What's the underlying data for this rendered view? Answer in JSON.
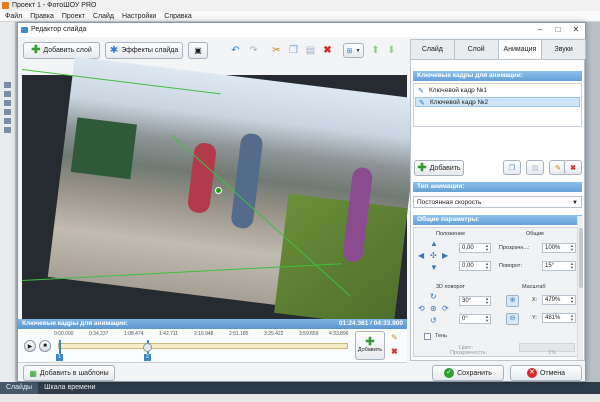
{
  "app": {
    "title": "Проект 1 - ФотоШОУ PRO",
    "menu": [
      "Файл",
      "Правка",
      "Проект",
      "Слайд",
      "Настройки",
      "Справка"
    ],
    "bottom_tabs": [
      "Слайды",
      "Шкала времени"
    ],
    "status": ""
  },
  "dialog": {
    "title": "Редактор слайда",
    "toolbar": {
      "add_layer": "Добавить слой",
      "slide_effects": "Эффекты слайда"
    },
    "timeline": {
      "header": "Ключевые кадры для анимации:",
      "time": "01:24.361 / 04:33.900",
      "ticks": [
        "0:00.000",
        "0:34.237",
        "1:08.474",
        "1:42.711",
        "2:16.948",
        "2:51.185",
        "3:25.422",
        "3:59.659",
        "4:33.896"
      ],
      "markers": [
        "1",
        "2"
      ],
      "add_label": "Добавить"
    },
    "tabs": [
      "Слайд",
      "Слой",
      "Анимация",
      "Звуки"
    ],
    "active_tab": "Анимация",
    "panel": {
      "keyframes_header": "Ключевые кадры для анимации:",
      "keyframes": [
        "Ключевой кадр №1",
        "Ключевой кадр №2"
      ],
      "add_label": "Добавить",
      "anim_type_header": "Тип анимации:",
      "anim_type_value": "Постоянная скорость",
      "params_header": "Общие параметры:",
      "position_label": "Положение",
      "general_label": "Общие",
      "pos_x": "0,00",
      "pos_y": "0,00",
      "opacity_label": "Прозрачн...:",
      "opacity_value": "100%",
      "rotate_label": "Поворот:",
      "rotate_value": "15°",
      "rot3d_label": "3D поворот",
      "scale_label": "Масштаб",
      "rot3d_a": "30°",
      "rot3d_b": "0°",
      "scale_x_label": "X:",
      "scale_x": "479%",
      "scale_y_label": "Y:",
      "scale_y": "481%",
      "shadow_label": "Тень",
      "color_label": "Цвет:",
      "transparency_label": "Прозрачность:",
      "transparency_value": "1%"
    },
    "buttons": {
      "templates": "Добавить в шаблоны",
      "save": "Сохранить",
      "cancel": "Отмена"
    }
  },
  "colors": {
    "accent_blue": "#65a1d6",
    "handle_green": "#1a9f1a",
    "cancel_red": "#d62b2b"
  }
}
